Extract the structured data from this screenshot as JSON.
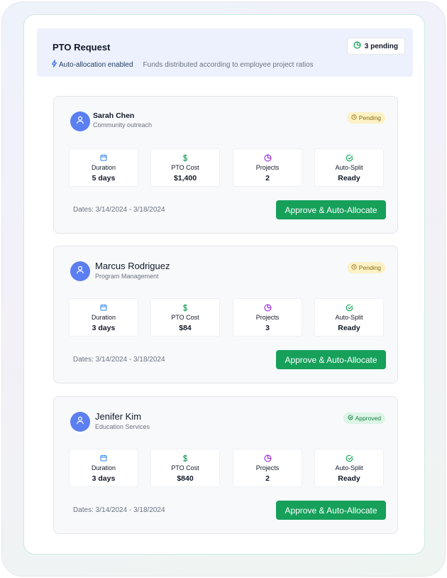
{
  "header": {
    "title": "PTO Request",
    "pending_count": "3 pending",
    "auto_allocation": "Auto-allocation enabled",
    "description": "Funds distributed according to employee project ratios"
  },
  "labels": {
    "duration": "Duration",
    "pto_cost": "PTO Cost",
    "projects": "Projects",
    "auto_split": "Auto-Split",
    "approve_button": "Approve & Auto-Allocate"
  },
  "requests": [
    {
      "name": "Sarah Chen",
      "department": "Community outreach",
      "status": "Pending",
      "duration": "5 days",
      "pto_cost": "$1,400",
      "projects": "2",
      "auto_split": "Ready",
      "dates": "Dates: 3/14/2024 - 3/18/2024"
    },
    {
      "name": "Marcus Rodriguez",
      "department": "Program Management",
      "status": "Pending",
      "duration": "3 days",
      "pto_cost": "$84",
      "projects": "3",
      "auto_split": "Ready",
      "dates": "Dates: 3/14/2024 - 3/18/2024"
    },
    {
      "name": "Jenifer Kim",
      "department": "Education Services",
      "status": "Approved",
      "duration": "3 days",
      "pto_cost": "$840",
      "projects": "2",
      "auto_split": "Ready",
      "dates": "Dates: 3/14/2024 - 3/18/2024"
    }
  ],
  "colors": {
    "accent_green": "#16a05a",
    "avatar_blue": "#5b7ff0",
    "pending_bg": "#fdf1c6",
    "approved_bg": "#dcf5e6",
    "header_bg": "#edf1fd"
  },
  "icons": {
    "pending_count": "pie-chart-icon",
    "auto_allocation": "lightning-icon",
    "avatar": "user-icon",
    "duration": "calendar-icon",
    "pto_cost": "dollar-icon",
    "projects": "pie-chart-icon",
    "auto_split": "check-circle-icon",
    "pending_status": "clock-icon",
    "approved_status": "check-circle-icon"
  }
}
